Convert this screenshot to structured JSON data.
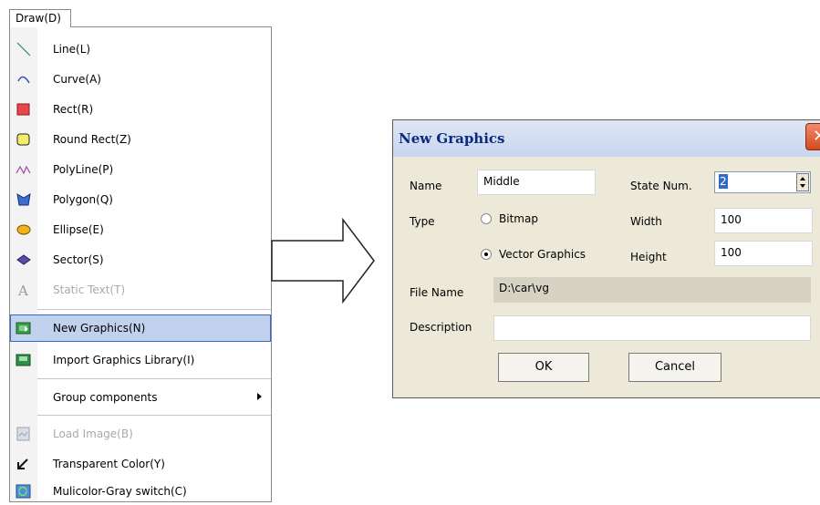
{
  "menu": {
    "title": "Draw(D)",
    "items": [
      {
        "label": "Line(L)",
        "icon": "line-icon"
      },
      {
        "label": "Curve(A)",
        "icon": "curve-icon"
      },
      {
        "label": "Rect(R)",
        "icon": "rect-icon"
      },
      {
        "label": "Round Rect(Z)",
        "icon": "round-rect-icon"
      },
      {
        "label": "PolyLine(P)",
        "icon": "polyline-icon"
      },
      {
        "label": "Polygon(Q)",
        "icon": "polygon-icon"
      },
      {
        "label": "Ellipse(E)",
        "icon": "ellipse-icon"
      },
      {
        "label": "Sector(S)",
        "icon": "sector-icon"
      },
      {
        "label": "Static Text(T)",
        "icon": "static-text-icon",
        "disabled": true
      },
      {
        "label": "New Graphics(N)",
        "icon": "new-graphics-icon",
        "highlighted": true
      },
      {
        "label": "Import Graphics Library(I)",
        "icon": "import-library-icon"
      },
      {
        "label": "Group components",
        "icon": "",
        "submenu": true
      },
      {
        "label": "Load Image(B)",
        "icon": "load-image-icon",
        "disabled": true
      },
      {
        "label": "Transparent Color(Y)",
        "icon": "transparent-color-icon"
      },
      {
        "label": "Mulicolor-Gray switch(C)",
        "icon": "color-gray-switch-icon"
      }
    ]
  },
  "dialog": {
    "title": "New Graphics",
    "name_label": "Name",
    "name_value": "Middle",
    "state_num_label": "State Num.",
    "state_num_value": "2",
    "type_label": "Type",
    "type_options": [
      "Bitmap",
      "Vector Graphics"
    ],
    "type_selected": "Vector Graphics",
    "width_label": "Width",
    "width_value": "100",
    "height_label": "Height",
    "height_value": "100",
    "file_name_label": "File Name",
    "file_name_value": "D:\\car\\vg",
    "description_label": "Description",
    "description_value": "",
    "ok_label": "OK",
    "cancel_label": "Cancel"
  },
  "colors": {
    "menu_highlight": "#c1d2ee",
    "dialog_background": "#ece9d8",
    "title_text": "#0a2a80",
    "close_button": "#d34a1e"
  }
}
